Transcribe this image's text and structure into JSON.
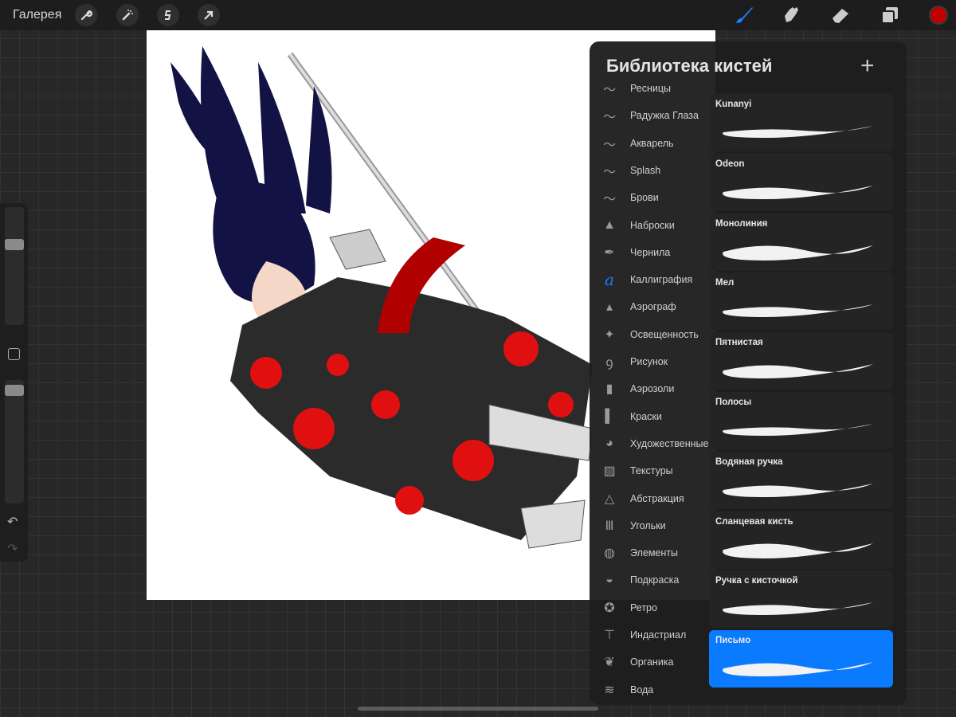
{
  "topbar": {
    "gallery_label": "Галерея",
    "tools": [
      "wrench-icon",
      "magic-wand-icon",
      "selection-icon",
      "transform-arrow-icon"
    ],
    "right_tools": [
      "brush-icon",
      "smudge-icon",
      "eraser-icon",
      "layers-icon"
    ],
    "current_color": "#c00000",
    "accent": "#1e7bff"
  },
  "panel": {
    "title": "Библиотека кистей",
    "add_label": "+",
    "categories": [
      {
        "label": "Ресницы",
        "icon": "stroke"
      },
      {
        "label": "Радужка Глаза",
        "icon": "stroke"
      },
      {
        "label": "Акварель",
        "icon": "stroke"
      },
      {
        "label": "Splash",
        "icon": "stroke"
      },
      {
        "label": "Брови",
        "icon": "stroke"
      },
      {
        "label": "Наброски",
        "icon": "pencil"
      },
      {
        "label": "Чернила",
        "icon": "pen-nib"
      },
      {
        "label": "Каллиграфия",
        "icon": "calligraphy",
        "active": true
      },
      {
        "label": "Аэрограф",
        "icon": "airbrush"
      },
      {
        "label": "Освещенность",
        "icon": "sparkle"
      },
      {
        "label": "Рисунок",
        "icon": "squiggle"
      },
      {
        "label": "Аэрозоли",
        "icon": "spray-can"
      },
      {
        "label": "Краски",
        "icon": "paint-brush"
      },
      {
        "label": "Художественные",
        "icon": "palette"
      },
      {
        "label": "Текстуры",
        "icon": "texture"
      },
      {
        "label": "Абстракция",
        "icon": "triangle"
      },
      {
        "label": "Угольки",
        "icon": "charcoal"
      },
      {
        "label": "Элементы",
        "icon": "globe"
      },
      {
        "label": "Подкраска",
        "icon": "shell"
      },
      {
        "label": "Ретро",
        "icon": "star-circle"
      },
      {
        "label": "Индастриал",
        "icon": "anvil"
      },
      {
        "label": "Органика",
        "icon": "leaf"
      },
      {
        "label": "Вода",
        "icon": "waves"
      }
    ],
    "brushes": [
      {
        "name": "Kunanyi"
      },
      {
        "name": "Odeon"
      },
      {
        "name": "Монолиния"
      },
      {
        "name": "Мел"
      },
      {
        "name": "Пятнистая"
      },
      {
        "name": "Полосы"
      },
      {
        "name": "Водяная ручка"
      },
      {
        "name": "Сланцевая кисть"
      },
      {
        "name": "Ручка с кисточкой"
      },
      {
        "name": "Письмо",
        "selected": true
      }
    ]
  },
  "sidebar": {
    "brush_size": 0.9,
    "opacity": 0.95
  },
  "selected_color": "#0a7aff"
}
